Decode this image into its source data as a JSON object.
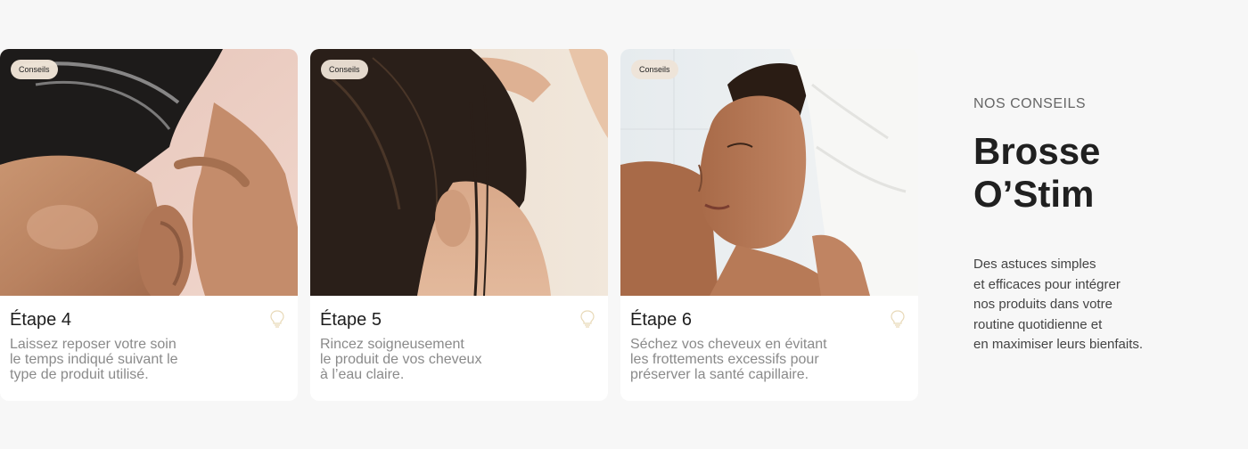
{
  "cards": [
    {
      "badge": "Conseils",
      "title": "Étape 4",
      "description": "Laissez reposer votre soin\nle temps indiqué suivant le\ntype de produit utilisé.",
      "image_alt": "Woman applying hair care product to scalp",
      "icon": "lightbulb-icon"
    },
    {
      "badge": "Conseils",
      "title": "Étape 5",
      "description": "Rincez soigneusement\nle produit de vos cheveux\nà l’eau claire.",
      "image_alt": "Woman rinsing wet hair",
      "icon": "lightbulb-icon"
    },
    {
      "badge": "Conseils",
      "title": "Étape 6",
      "description": "Séchez vos cheveux en évitant\nles frottements excessifs pour\npréserver la santé capillaire.",
      "image_alt": "Woman with hair wrapped in a white towel",
      "icon": "lightbulb-icon"
    }
  ],
  "side": {
    "eyebrow": "NOS CONSEILS",
    "title": "Brosse\nO’Stim",
    "text": "Des astuces simples\net efficaces pour intégrer\nnos produits dans votre\nroutine quotidienne et\nen maximiser leurs bienfaits."
  },
  "colors": {
    "background": "#f7f7f7",
    "card": "#ffffff",
    "badge": "#eee4d7",
    "icon": "#e8d9b8"
  }
}
